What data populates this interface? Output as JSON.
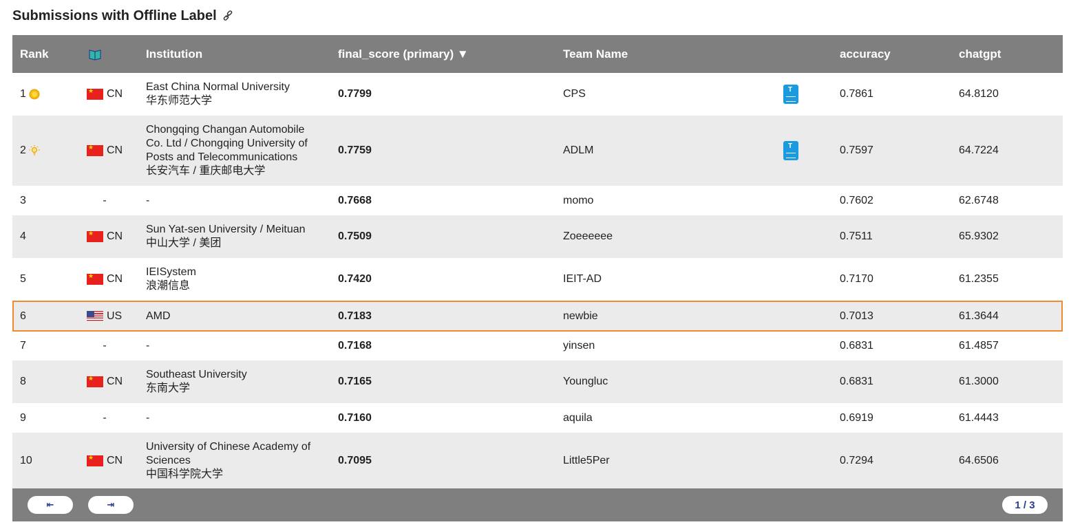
{
  "title": "Submissions with Offline Label",
  "columns": {
    "rank": "Rank",
    "institution": "Institution",
    "score": "final_score (primary) ▼",
    "team": "Team Name",
    "accuracy": "accuracy",
    "chatgpt": "chatgpt"
  },
  "rows": [
    {
      "rank": "1",
      "cc": "CN",
      "inst": [
        "East China Normal University",
        "华东师范大学"
      ],
      "score": "0.7799",
      "team": "CPS",
      "acc": "0.7861",
      "gpt": "64.8120"
    },
    {
      "rank": "2",
      "cc": "CN",
      "inst": [
        "Chongqing Changan Automobile",
        "Co. Ltd / Chongqing University of",
        "Posts and Telecommunications",
        "长安汽车 / 重庆邮电大学"
      ],
      "score": "0.7759",
      "team": "ADLM",
      "acc": "0.7597",
      "gpt": "64.7224"
    },
    {
      "rank": "3",
      "cc": "-",
      "inst": [
        "-"
      ],
      "score": "0.7668",
      "team": "momo",
      "acc": "0.7602",
      "gpt": "62.6748"
    },
    {
      "rank": "4",
      "cc": "CN",
      "inst": [
        "Sun Yat-sen University / Meituan",
        "中山大学 / 美团"
      ],
      "score": "0.7509",
      "team": "Zoeeeeee",
      "acc": "0.7511",
      "gpt": "65.9302"
    },
    {
      "rank": "5",
      "cc": "CN",
      "inst": [
        "IEISystem",
        "浪潮信息"
      ],
      "score": "0.7420",
      "team": "IEIT-AD",
      "acc": "0.7170",
      "gpt": "61.2355"
    },
    {
      "rank": "6",
      "cc": "US",
      "inst": [
        "AMD"
      ],
      "score": "0.7183",
      "team": "newbie",
      "acc": "0.7013",
      "gpt": "61.3644"
    },
    {
      "rank": "7",
      "cc": "-",
      "inst": [
        "-"
      ],
      "score": "0.7168",
      "team": "yinsen",
      "acc": "0.6831",
      "gpt": "61.4857"
    },
    {
      "rank": "8",
      "cc": "CN",
      "inst": [
        "Southeast University",
        "东南大学"
      ],
      "score": "0.7165",
      "team": "Youngluc",
      "acc": "0.6831",
      "gpt": "61.3000"
    },
    {
      "rank": "9",
      "cc": "-",
      "inst": [
        "-"
      ],
      "score": "0.7160",
      "team": "aquila",
      "acc": "0.6919",
      "gpt": "61.4443"
    },
    {
      "rank": "10",
      "cc": "CN",
      "inst": [
        "University of Chinese Academy of",
        "Sciences",
        "中国科学院大学"
      ],
      "score": "0.7095",
      "team": "Little5Per",
      "acc": "0.7294",
      "gpt": "64.6506"
    }
  ],
  "pagination": {
    "first_label": "⇤",
    "last_label": "⇥",
    "page": "1 / 3"
  }
}
